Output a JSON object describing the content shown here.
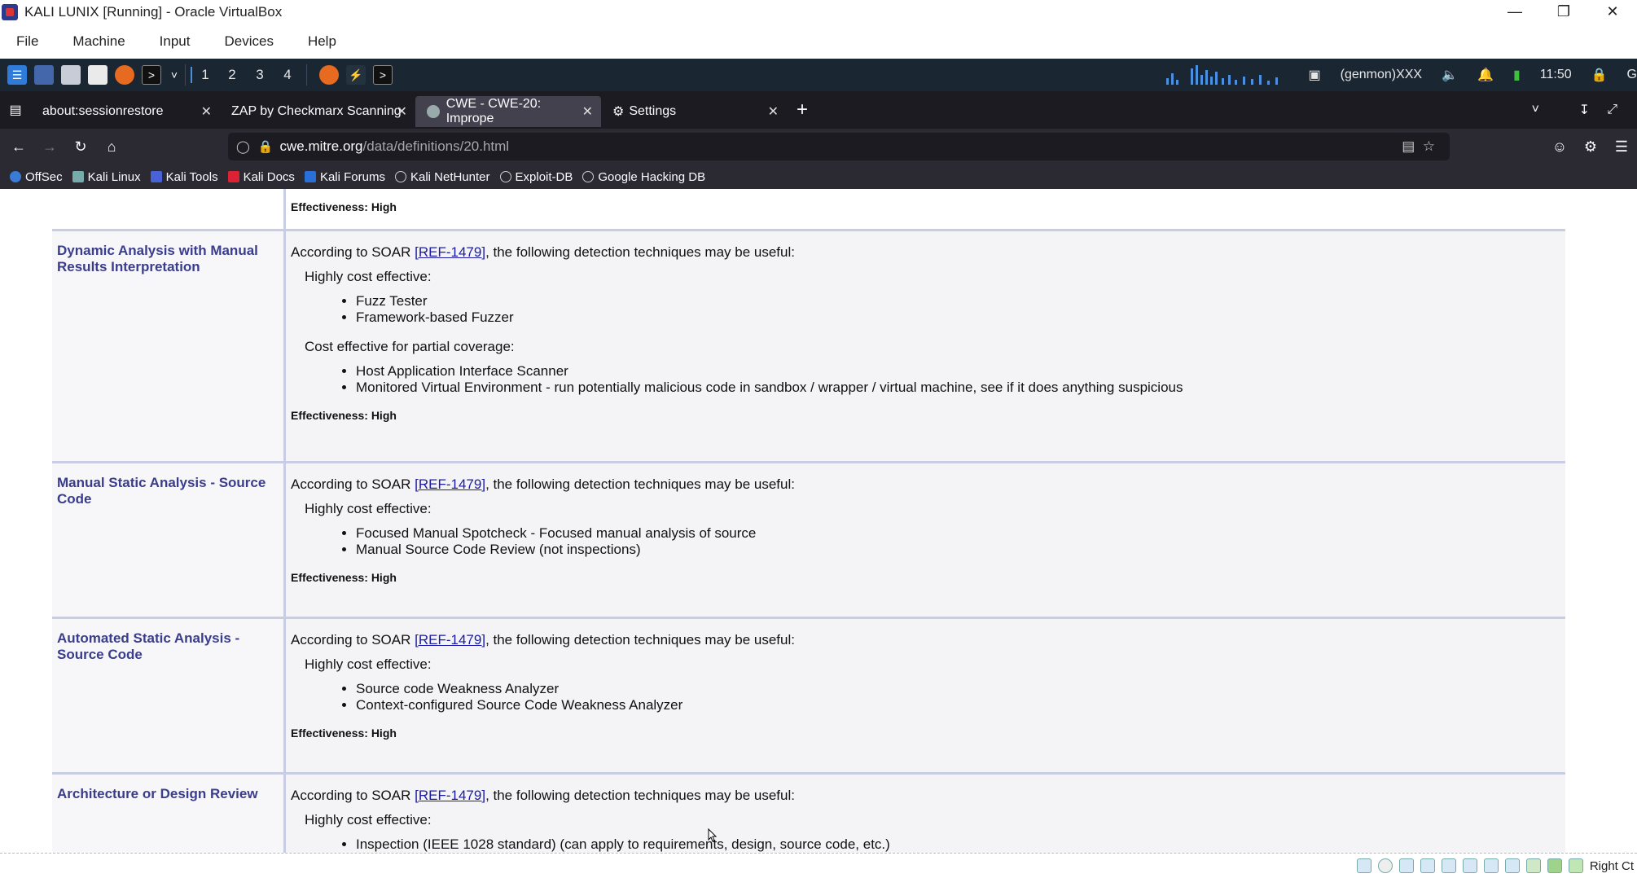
{
  "vbox": {
    "title": "KALI LUNIX [Running] - Oracle VirtualBox",
    "menu": [
      "File",
      "Machine",
      "Input",
      "Devices",
      "Help"
    ],
    "status_text": "Right Ct"
  },
  "panel": {
    "workspaces": [
      "1",
      "2",
      "3",
      "4"
    ],
    "user": "(genmon)XXX",
    "clock": "11:50"
  },
  "tabs": [
    {
      "label": "about:sessionrestore",
      "active": false
    },
    {
      "label": "ZAP by Checkmarx Scanning",
      "active": false
    },
    {
      "label": "CWE - CWE-20: Imprope",
      "active": true
    },
    {
      "label": "Settings",
      "active": false
    }
  ],
  "url": {
    "host": "cwe.mitre.org",
    "path": "/data/definitions/20.html"
  },
  "bookmarks": [
    "OffSec",
    "Kali Linux",
    "Kali Tools",
    "Kali Docs",
    "Kali Forums",
    "Kali NetHunter",
    "Exploit-DB",
    "Google Hacking DB"
  ],
  "content": {
    "top_effectiveness": "Effectiveness: High",
    "rows": [
      {
        "name": "Dynamic Analysis with Manual Results Interpretation",
        "intro_prefix": "According to SOAR ",
        "ref": "[REF-1479]",
        "intro_suffix": ", the following detection techniques may be useful:",
        "group1": "Highly cost effective:",
        "items1": [
          "Fuzz Tester",
          "Framework-based Fuzzer"
        ],
        "group2": "Cost effective for partial coverage:",
        "items2": [
          "Host Application Interface Scanner",
          "Monitored Virtual Environment - run potentially malicious code in sandbox / wrapper / virtual machine, see if it does anything suspicious"
        ],
        "effectiveness": "Effectiveness: High"
      },
      {
        "name": "Manual Static Analysis - Source Code",
        "intro_prefix": "According to SOAR ",
        "ref": "[REF-1479]",
        "intro_suffix": ", the following detection techniques may be useful:",
        "group1": "Highly cost effective:",
        "items1": [
          "Focused Manual Spotcheck - Focused manual analysis of source",
          "Manual Source Code Review (not inspections)"
        ],
        "effectiveness": "Effectiveness: High"
      },
      {
        "name": "Automated Static Analysis - Source Code",
        "intro_prefix": "According to SOAR ",
        "ref": "[REF-1479]",
        "intro_suffix": ", the following detection techniques may be useful:",
        "group1": "Highly cost effective:",
        "items1": [
          "Source code Weakness Analyzer",
          "Context-configured Source Code Weakness Analyzer"
        ],
        "effectiveness": "Effectiveness: High"
      },
      {
        "name": "Architecture or Design Review",
        "intro_prefix": "According to SOAR ",
        "ref": "[REF-1479]",
        "intro_suffix": ", the following detection techniques may be useful:",
        "group1": "Highly cost effective:",
        "items1": [
          "Inspection (IEEE 1028 standard) (can apply to requirements, design, source code, etc.)"
        ]
      }
    ]
  }
}
